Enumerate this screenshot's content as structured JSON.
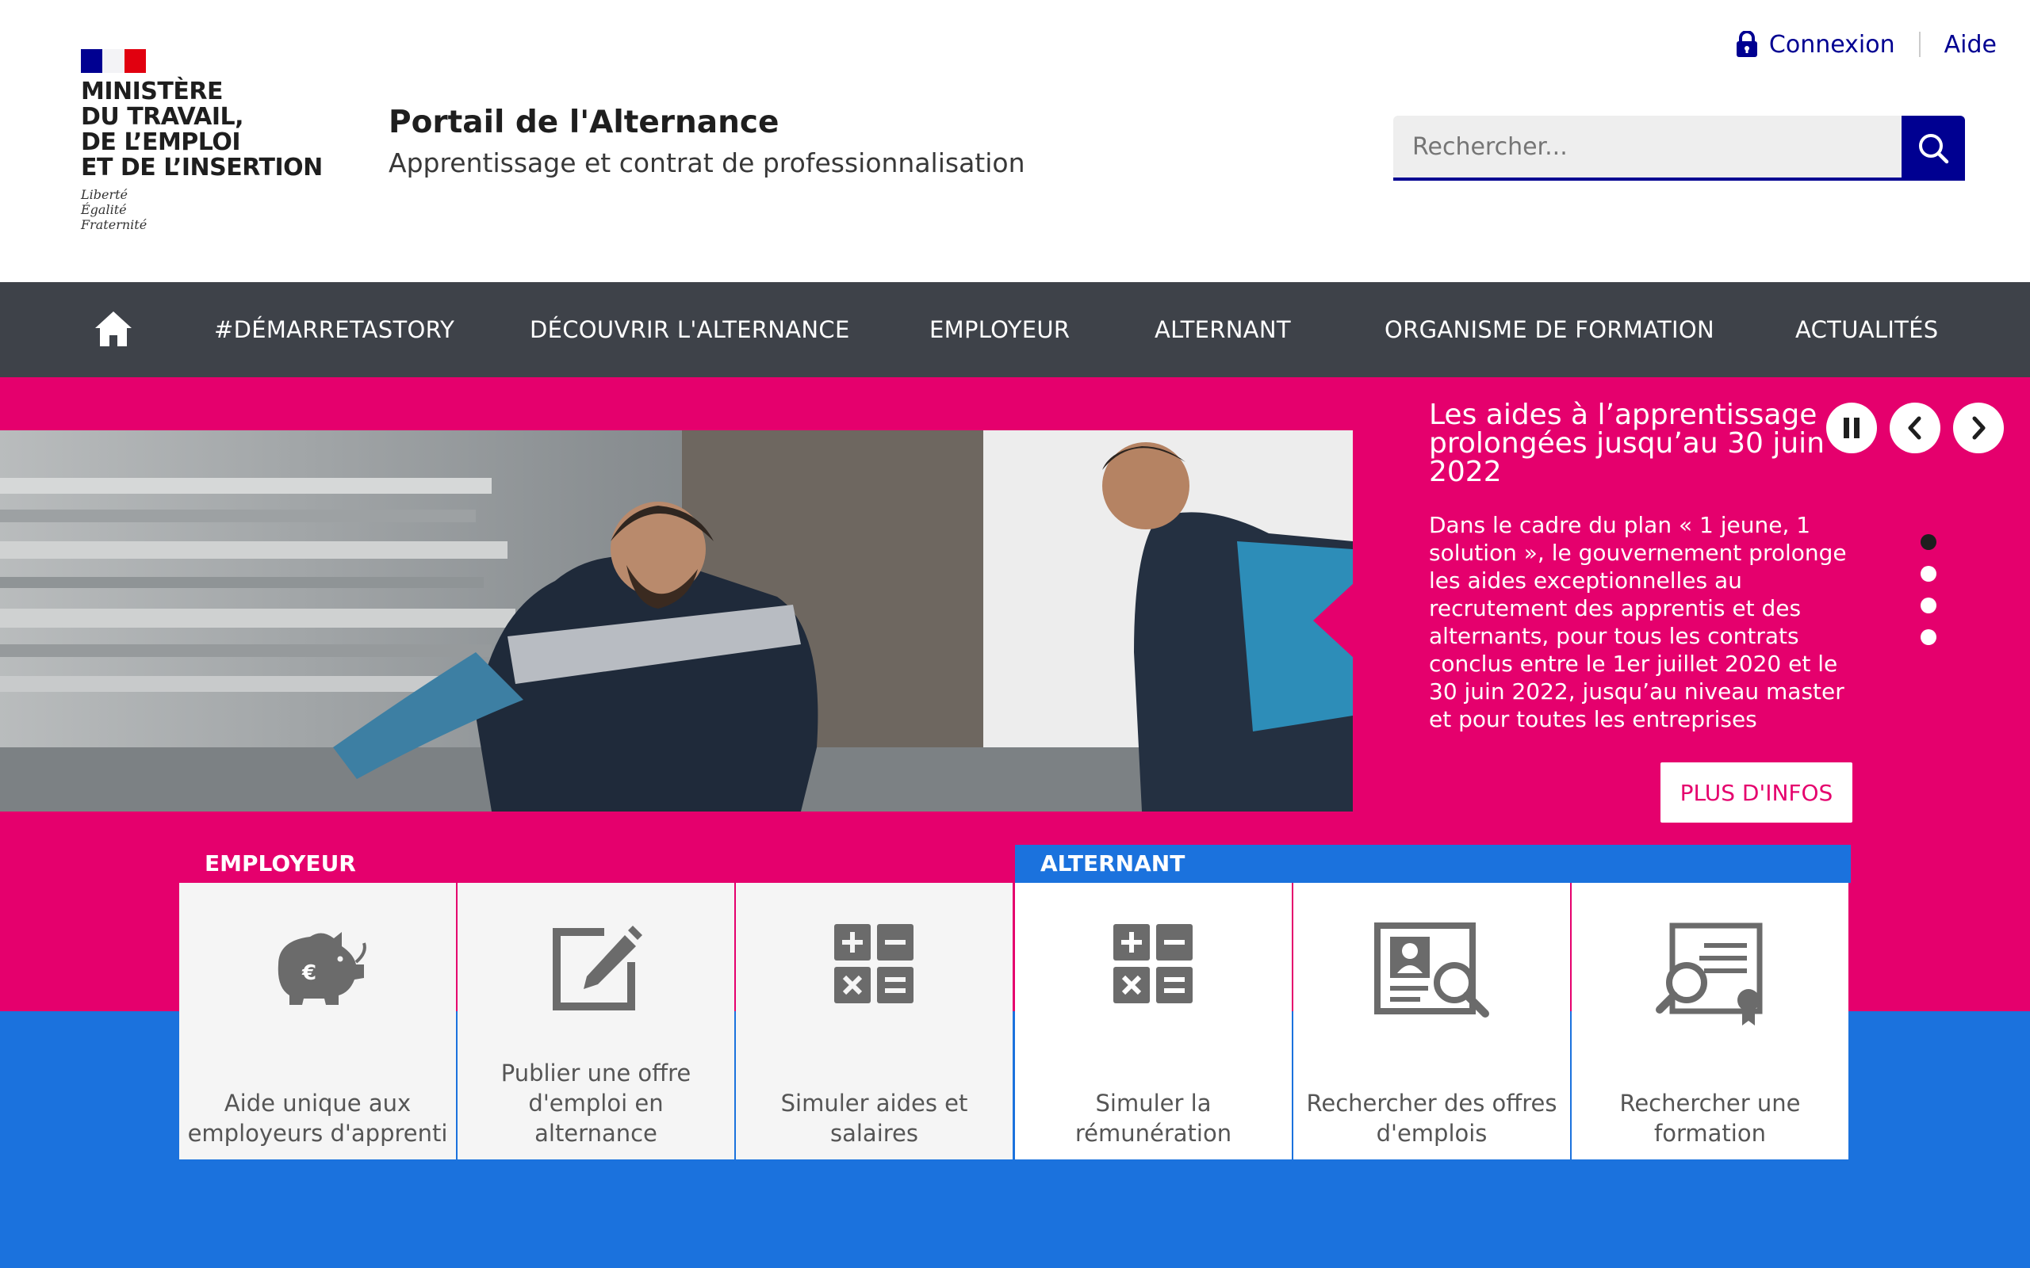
{
  "header": {
    "ministry_lines": [
      "MINISTÈRE",
      "DU TRAVAIL,",
      "DE L’EMPLOI",
      "ET DE L’INSERTION"
    ],
    "motto_lines": [
      "Liberté",
      "Égalité",
      "Fraternité"
    ],
    "site_title": "Portail de l'Alternance",
    "site_subtitle": "Apprentissage et contrat de professionnalisation",
    "login_label": "Connexion",
    "help_label": "Aide",
    "search_placeholder": "Rechercher..."
  },
  "nav": {
    "items": [
      {
        "label": "#DÉMARRETASTORY"
      },
      {
        "label": "DÉCOUVRIR L'ALTERNANCE"
      },
      {
        "label": "EMPLOYEUR"
      },
      {
        "label": "ALTERNANT"
      },
      {
        "label": "ORGANISME DE FORMATION"
      },
      {
        "label": "ACTUALITÉS"
      }
    ]
  },
  "carousel": {
    "title": "Les aides à l’apprentissage prolongées jusqu’au 30 juin 2022",
    "text": "Dans le cadre du plan « 1 jeune, 1 solution », le gouvernement prolonge les aides exceptionnelles au recrutement des apprentis et des alternants, pour tous les contrats conclus entre le 1er juillet 2020 et le 30 juin 2022, jusqu’au niveau master et pour toutes les entreprises jusqu’au",
    "button_label": "PLUS D'INFOS",
    "active_slide": 1,
    "slide_count": 4
  },
  "sections": {
    "employeur": {
      "title": "EMPLOYEUR",
      "tiles": [
        {
          "label": "Aide unique aux employeurs d'apprenti",
          "icon": "piggy-bank-euro-icon"
        },
        {
          "label": "Publier une offre d'emploi en alternance",
          "icon": "edit-square-icon"
        },
        {
          "label": "Simuler aides et salaires",
          "icon": "calculator-icon"
        }
      ]
    },
    "alternant": {
      "title": "ALTERNANT",
      "tiles": [
        {
          "label": "Simuler la rémunération",
          "icon": "calculator-icon"
        },
        {
          "label": "Rechercher des offres d'emplois",
          "icon": "profile-search-icon"
        },
        {
          "label": "Rechercher une formation",
          "icon": "certificate-search-icon"
        }
      ]
    }
  },
  "colors": {
    "brand_blue": "#000091",
    "nav_bg": "#3e4249",
    "hero_pink": "#e5006d",
    "alternant_blue": "#1b72dd"
  }
}
